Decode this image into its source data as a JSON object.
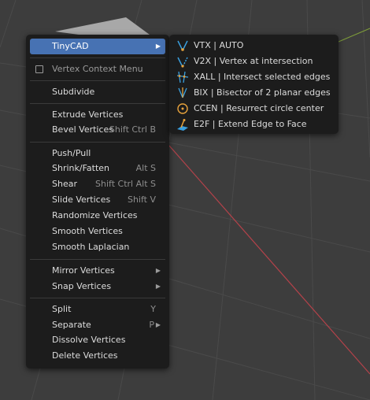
{
  "menu": {
    "tinycad": {
      "label": "TinyCAD"
    },
    "context_title": "Vertex Context Menu",
    "items": {
      "subdivide": {
        "label": "Subdivide"
      },
      "extrude": {
        "label": "Extrude Vertices"
      },
      "bevel": {
        "label": "Bevel Vertices",
        "shortcut": "Shift Ctrl B"
      },
      "push_pull": {
        "label": "Push/Pull"
      },
      "shrink_fatten": {
        "label": "Shrink/Fatten",
        "shortcut": "Alt S"
      },
      "shear": {
        "label": "Shear",
        "shortcut": "Shift Ctrl Alt S"
      },
      "slide": {
        "label": "Slide Vertices",
        "shortcut": "Shift V"
      },
      "randomize": {
        "label": "Randomize Vertices"
      },
      "smooth": {
        "label": "Smooth Vertices"
      },
      "smooth_laplacian": {
        "label": "Smooth Laplacian"
      },
      "mirror": {
        "label": "Mirror Vertices"
      },
      "snap": {
        "label": "Snap Vertices"
      },
      "split": {
        "label": "Split",
        "shortcut": "Y"
      },
      "separate": {
        "label": "Separate",
        "shortcut": "P"
      },
      "dissolve": {
        "label": "Dissolve Vertices"
      },
      "delete": {
        "label": "Delete Vertices"
      }
    }
  },
  "submenu": {
    "items": [
      {
        "label": "VTX | AUTO",
        "icon": "vtx-icon"
      },
      {
        "label": "V2X | Vertex at intersection",
        "icon": "v2x-icon"
      },
      {
        "label": "XALL | Intersect selected edges",
        "icon": "xall-icon"
      },
      {
        "label": "BIX |  Bisector of 2 planar edges",
        "icon": "bix-icon"
      },
      {
        "label": "CCEN | Resurrect circle center",
        "icon": "ccen-icon"
      },
      {
        "label": "E2F | Extend Edge to Face",
        "icon": "e2f-icon"
      }
    ]
  },
  "colors": {
    "viewport_bg": "#3d3d3d",
    "menu_bg": "#1c1c1c",
    "highlight": "#4772b3",
    "x_axis": "#b4424a",
    "y_axis": "#7c9a3a",
    "icon_accent": "#e8a33c",
    "icon_blue": "#3aa0e0"
  }
}
